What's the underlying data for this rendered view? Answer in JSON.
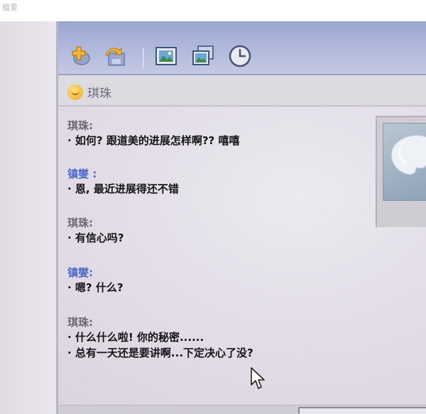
{
  "topbar": {
    "title": "植爱"
  },
  "toolbar": {
    "icons": [
      "add-contact-icon",
      "send-file-icon",
      "picture-icon",
      "gallery-icon",
      "history-clock-icon"
    ]
  },
  "header": {
    "contact_name": "琪珠"
  },
  "messages": [
    {
      "sender": "琪珠:",
      "lines": [
        "· 如何? 跟道美的进展怎样啊?? 嘻嘻"
      ]
    },
    {
      "sender": "镇燮 :",
      "lines": [
        "· 恩, 最近进展得还不错"
      ]
    },
    {
      "sender": "琪珠:",
      "lines": [
        "· 有信心吗?"
      ]
    },
    {
      "sender": "镇燮:",
      "lines": [
        "· 嗯? 什么?"
      ]
    },
    {
      "sender": "琪珠:",
      "lines": [
        "· 什么什么啦! 你的秘密......",
        "· 总有一天还是要讲啊...下定决心了没?"
      ]
    }
  ],
  "colors": {
    "toolbar": "#aeb7da",
    "self_name": "#4f68c6",
    "other_name": "#6a6873"
  }
}
